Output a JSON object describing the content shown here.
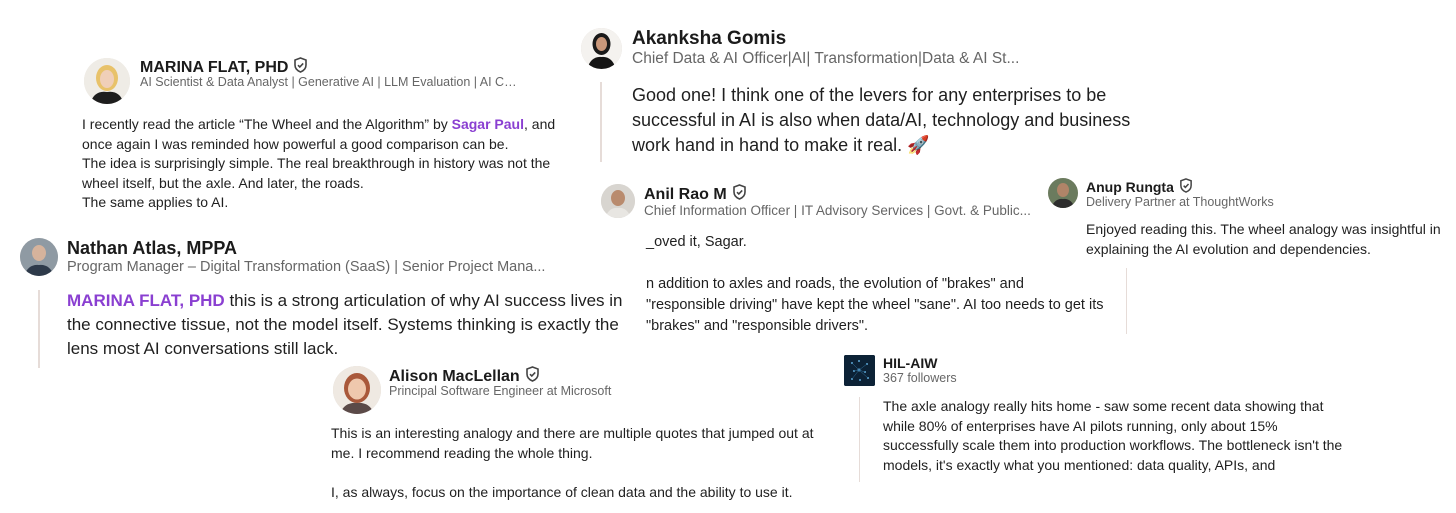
{
  "comments": {
    "marina": {
      "name": "MARINA FLAT, PHD",
      "headline": "AI Scientist & Data Analyst | Generative AI | LLM Evaluation | AI Co...",
      "body_1_before": "I recently read the article “The Wheel and the Algorithm” by ",
      "body_1_mention": "Sagar Paul",
      "body_1_after": ", and once again I was reminded how powerful a good comparison can be.",
      "body_2": "The idea is surprisingly simple. The real breakthrough in history was not the wheel itself, but the axle. And later, the roads.",
      "body_3": "The same applies to AI."
    },
    "nathan": {
      "name": "Nathan Atlas, MPPA",
      "headline": "Program Manager – Digital Transformation (SaaS) | Senior Project Mana...",
      "mention": "MARINA FLAT, PHD",
      "body": " this is a strong articulation of why AI success lives in the connective tissue, not the model itself. Systems thinking is exactly the lens most AI conversations still lack."
    },
    "akanksha": {
      "name": "Akanksha Gomis",
      "headline": "Chief Data & AI Officer|AI| Transformation|Data & AI St...",
      "body": "Good one! I think one of the levers for any enterprises to be successful in AI is also when data/AI, technology and business work hand in hand to make it real. 🚀"
    },
    "anil": {
      "name": "Anil Rao M",
      "headline": "Chief Information Officer | IT Advisory Services | Govt. & Public...",
      "body_1": "_oved it, Sagar.",
      "body_2": "n addition to axles and roads, the evolution of \"brakes\" and \"responsible driving\" have kept the wheel \"sane\". AI too needs to get its \"brakes\" and \"responsible drivers\"."
    },
    "anup": {
      "name": "Anup Rungta",
      "headline": "Delivery Partner at ThoughtWorks",
      "body": "Enjoyed reading this. The wheel analogy was insightful in explaining the AI evolution and dependencies."
    },
    "alison": {
      "name": "Alison MacLellan",
      "headline": "Principal Software Engineer at Microsoft",
      "body_1": "This is an interesting analogy and there are multiple quotes that jumped out at me. I recommend reading the whole thing.",
      "body_2": "I, as always, focus on the importance of clean data and the ability to use it."
    },
    "hil": {
      "name": "HIL-AIW",
      "followers": "367 followers",
      "body": "The axle analogy really hits home - saw some recent data showing that while 80% of enterprises have AI pilots running, only about 15% successfully scale them into production workflows. The bottleneck isn't the models, it's exactly what you mentioned: data quality, APIs, and"
    }
  },
  "colors": {
    "mention": "#8a3fd1",
    "thread_line": "#e6dcd8",
    "muted": "#666666"
  },
  "icons": {
    "verified": "shield-check-icon"
  }
}
